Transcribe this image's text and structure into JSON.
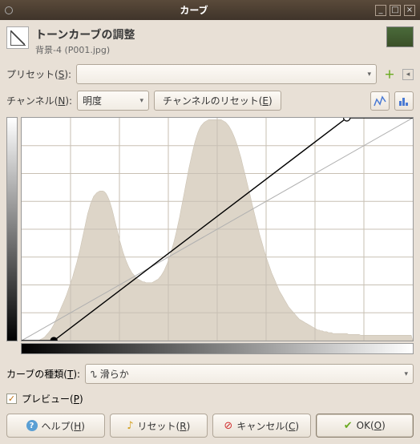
{
  "window": {
    "title": "カーブ"
  },
  "header": {
    "title": "トーンカーブの調整",
    "subtitle": "背景-4 (P001.jpg)"
  },
  "preset": {
    "label": "プリセット(S):"
  },
  "channel": {
    "label": "チャンネル(N):",
    "value": "明度",
    "reset_label": "チャンネルのリセット(E)"
  },
  "curve_type": {
    "label": "カーブの種類(T):",
    "value": "滑らか",
    "icon": "⌒"
  },
  "preview": {
    "label": "プレビュー(P)",
    "checked": true
  },
  "actions": {
    "help": "ヘルプ(H)",
    "reset": "リセット(R)",
    "cancel": "キャンセル(C)",
    "ok": "OK(O)"
  },
  "chart_data": {
    "type": "line",
    "title": "",
    "xlabel": "",
    "ylabel": "",
    "xlim": [
      0,
      255
    ],
    "ylim": [
      0,
      255
    ],
    "histogram": [
      0,
      0,
      0,
      0,
      0,
      0,
      0,
      0,
      0,
      0,
      0,
      0,
      1,
      2,
      3,
      4,
      6,
      8,
      10,
      12,
      15,
      18,
      22,
      26,
      30,
      34,
      38,
      42,
      46,
      50,
      55,
      60,
      65,
      70,
      76,
      82,
      88,
      95,
      102,
      110,
      118,
      126,
      134,
      142,
      148,
      154,
      158,
      162,
      164,
      166,
      167,
      168,
      168,
      168,
      167,
      165,
      162,
      158,
      153,
      147,
      140,
      133,
      126,
      119,
      112,
      106,
      100,
      95,
      90,
      86,
      82,
      79,
      76,
      74,
      72,
      70,
      69,
      68,
      67,
      66,
      66,
      65,
      65,
      65,
      65,
      65,
      66,
      67,
      68,
      69,
      71,
      73,
      76,
      79,
      83,
      87,
      92,
      97,
      103,
      109,
      116,
      123,
      131,
      139,
      148,
      157,
      166,
      175,
      184,
      193,
      201,
      209,
      216,
      223,
      229,
      234,
      238,
      241,
      243,
      245,
      246,
      247,
      248,
      248,
      248,
      248,
      248,
      248,
      248,
      248,
      248,
      247,
      246,
      245,
      243,
      241,
      238,
      235,
      231,
      227,
      222,
      217,
      211,
      205,
      198,
      191,
      184,
      177,
      170,
      163,
      155,
      148,
      141,
      134,
      127,
      120,
      114,
      108,
      102,
      96,
      91,
      86,
      81,
      76,
      72,
      68,
      64,
      60,
      56,
      53,
      50,
      47,
      44,
      41,
      38,
      36,
      34,
      32,
      30,
      28,
      26,
      24,
      23,
      22,
      21,
      20,
      19,
      18,
      17,
      16,
      15,
      14,
      13,
      12,
      12,
      11,
      11,
      10,
      10,
      10,
      9,
      9,
      9,
      8,
      8,
      8,
      8,
      8,
      8,
      8,
      8,
      8,
      8,
      7,
      7,
      7,
      7,
      7,
      7,
      7,
      7,
      6,
      6,
      6,
      6,
      6,
      6,
      6,
      6,
      6,
      6,
      6,
      6,
      6,
      6,
      6,
      6,
      6,
      6,
      6,
      6,
      6,
      6,
      6,
      6,
      6,
      6,
      6,
      6,
      6,
      6,
      6,
      6,
      6,
      6,
      0
    ],
    "histogram_max": 250,
    "grid_divisions": 8,
    "curve_points": [
      {
        "x": 21,
        "y": 0
      },
      {
        "x": 212,
        "y": 255
      }
    ]
  }
}
